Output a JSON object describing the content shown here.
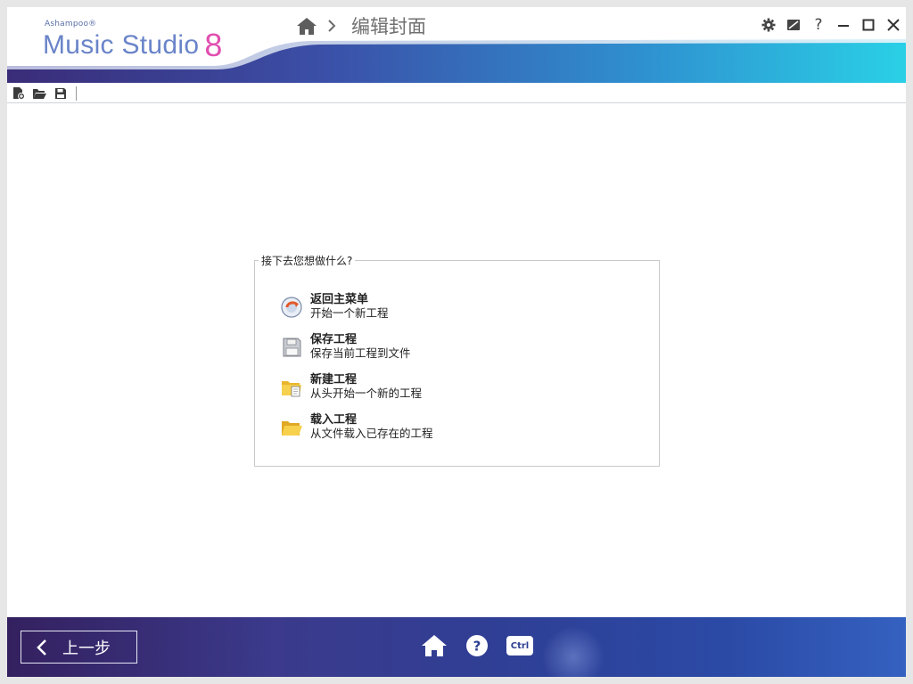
{
  "app": {
    "brand_small": "Ashampoo®",
    "brand_name": "Music Studio",
    "brand_version": "8"
  },
  "breadcrumb": {
    "home_icon": "home-icon",
    "current": "编辑封面"
  },
  "window_controls": {
    "help_label": "?"
  },
  "groupbox": {
    "legend": "接下去您想做什么?",
    "options": [
      {
        "title": "返回主菜单",
        "desc": "开始一个新工程",
        "icon": "return-menu-icon"
      },
      {
        "title": "保存工程",
        "desc": "保存当前工程到文件",
        "icon": "floppy-icon"
      },
      {
        "title": "新建工程",
        "desc": "从头开始一个新的工程",
        "icon": "new-folder-icon"
      },
      {
        "title": "载入工程",
        "desc": "从文件载入已存在的工程",
        "icon": "open-folder-icon"
      }
    ]
  },
  "footer": {
    "back_label": "上一步",
    "ctrl_label": "Ctrl"
  },
  "colors": {
    "accent_blue": "#6a84c9",
    "accent_pink": "#e04fb0",
    "footer_dark": "#34205f",
    "header_cyan": "#2bc4df"
  }
}
